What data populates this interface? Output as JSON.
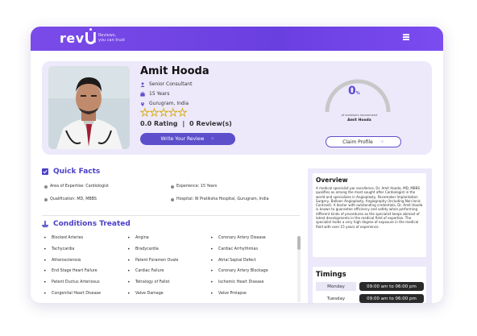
{
  "header": {
    "logo_text": "rev",
    "tagline_line1": "Reviews,",
    "tagline_line2": "you can trust",
    "menu_icon": "hamburger-icon"
  },
  "profile": {
    "name": "Amit Hooda",
    "designation": "Senior Consultant",
    "experience": "15 Years",
    "location": "Gurugram, India",
    "stars_filled": 0,
    "stars_total": 5,
    "rating_text": "0.0 Rating",
    "separator": "|",
    "reviews_text": "0 Review(s)",
    "write_review_label": "Write Your Review",
    "gauge_value": "0",
    "gauge_unit": "%",
    "gauge_caption": "of reviewers recommend",
    "gauge_name": "Amit Hooda",
    "claim_label": "Claim Profile",
    "accent": "#5d4ecb"
  },
  "quick_facts": {
    "title": "Quick Facts",
    "items": [
      "Area of Expertise: Cardiologist",
      "Experience: 15 Years",
      "Qualification: MD, MBBS",
      "Hospital: W Pratiksha Hospital, Gurugram, India"
    ]
  },
  "conditions": {
    "title": "Conditions Treated",
    "columns": [
      [
        "Blocked Arteries",
        "Tachycardia",
        "Atherosclerosis",
        "End Stage Heart Failure",
        "Patent Ductus Arteriosus",
        "Congenital Heart Disease"
      ],
      [
        "Angina",
        "Bradycardia",
        "Patent Foramen Ovale",
        "Cardiac Failure",
        "Tetralogy of Fallot",
        "Valve Damage"
      ],
      [
        "Coronary Artery Disease",
        "Cardiac Arrhythmias",
        "Atrial Septal Defect",
        "Coronary Artery Blockage",
        "Ischemic Heart Disease",
        "Valve Prolapse"
      ]
    ]
  },
  "overview": {
    "title": "Overview",
    "text": "A medical specialist par excellence, Dr. Amit Hooda, MD, MBBS qualifies as among the most sought after Cardiologist in the world and specializes in Angioplasty, Pacemaker Implantation Surgery, Balloon Angioplasty, Angiography (Including Non-Ionic Contrast). A doctor with outstanding credentials, Dr. Amit Hooda is known to guarantee efficiency and safety when performing different kinds of procedures as the specialist keeps abreast of latest developments in the medical field of expertise. The specialist holds a very high degree of exposure in the medical field with over 15 years of experience."
  },
  "timings": {
    "title": "Timings",
    "rows": [
      {
        "day": "Monday",
        "time": "09:00 am to 06:00 pm"
      },
      {
        "day": "Tuesday",
        "time": "09:00 am to 06:00 pm"
      }
    ]
  }
}
